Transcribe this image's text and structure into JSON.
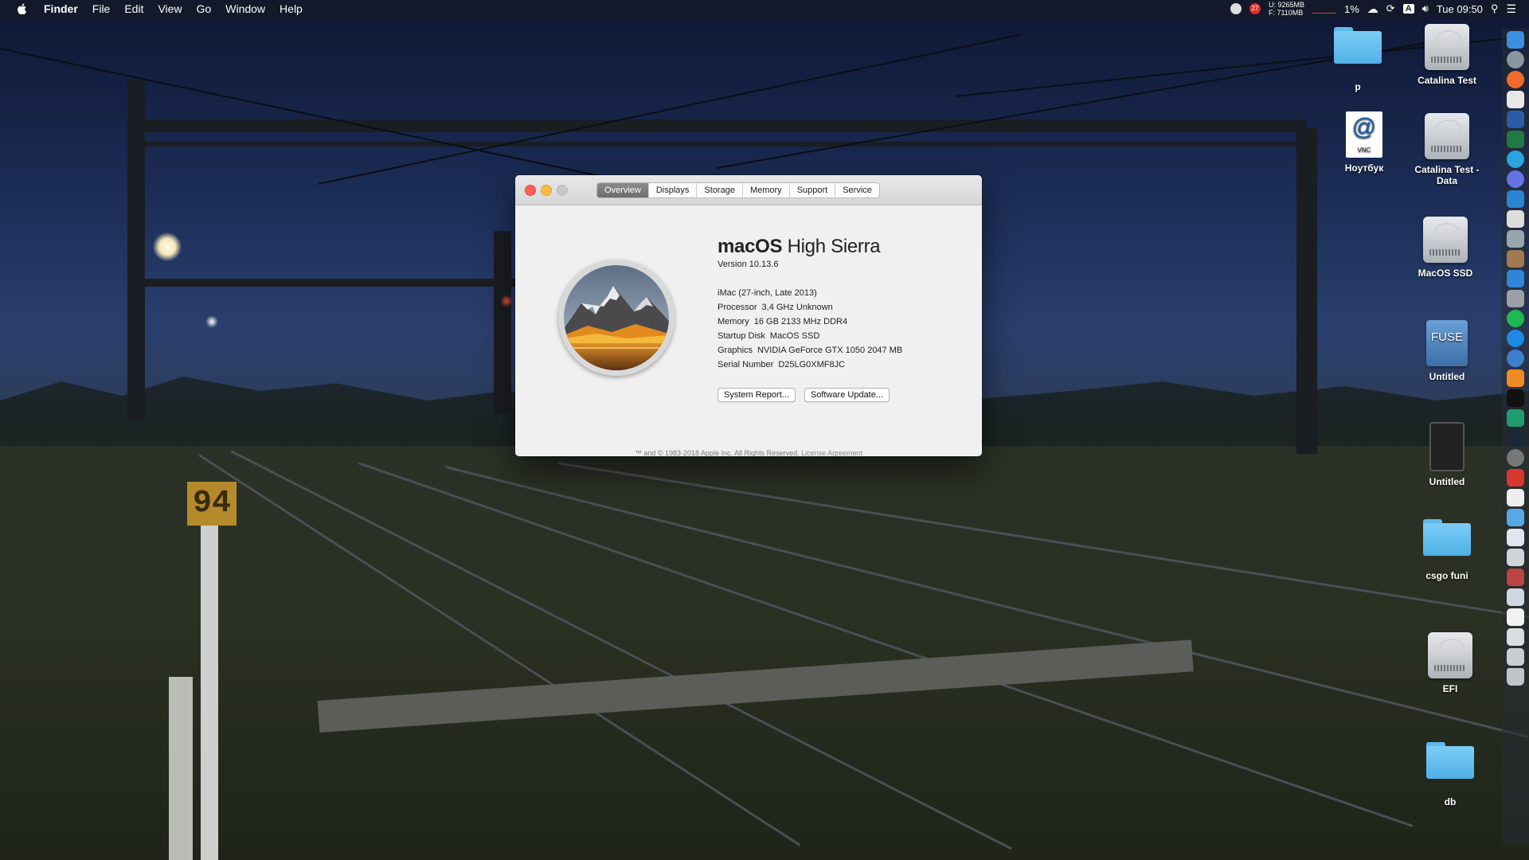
{
  "menubar": {
    "app": "Finder",
    "items": [
      "File",
      "Edit",
      "View",
      "Go",
      "Window",
      "Help"
    ],
    "status": {
      "notif_count": "27",
      "mem_used": "U: 9265MB",
      "mem_free": "F: 7110MB",
      "percent": "1%",
      "input_source": "A",
      "clock": "Tue 09:50"
    }
  },
  "desktop_icons": [
    {
      "label": "p"
    },
    {
      "label": "Catalina Test"
    },
    {
      "label": "Ноутбук",
      "vnc_text": "VNC"
    },
    {
      "label": "Catalina Test - Data"
    },
    {
      "label": "MacOS SSD"
    },
    {
      "label": "Untitled",
      "fuse_text": "FUSE"
    },
    {
      "label": "Untitled"
    },
    {
      "label": "csgo funi"
    },
    {
      "label": "EFI"
    },
    {
      "label": "db"
    }
  ],
  "wallpaper": {
    "sign_text": "94"
  },
  "window": {
    "tabs": [
      "Overview",
      "Displays",
      "Storage",
      "Memory",
      "Support",
      "Service"
    ],
    "active_tab": "Overview",
    "os_brand": "macOS",
    "os_name": "High Sierra",
    "version": "Version 10.13.6",
    "model": "iMac (27-inch, Late 2013)",
    "specs": [
      {
        "key": "Processor",
        "value": "3,4 GHz Unknown"
      },
      {
        "key": "Memory",
        "value": "16 GB 2133 MHz DDR4"
      },
      {
        "key": "Startup Disk",
        "value": "MacOS SSD"
      },
      {
        "key": "Graphics",
        "value": "NVIDIA GeForce GTX 1050 2047 MB"
      },
      {
        "key": "Serial Number",
        "value": "D25LG0XMF8JC"
      }
    ],
    "system_report_label": "System Report...",
    "software_update_label": "Software Update...",
    "footer_copyright": "™ and © 1983-2018 Apple Inc. All Rights Reserved.",
    "footer_license": "License Agreement"
  },
  "colors": {
    "close": "#fc605b",
    "minimize": "#fdbc40",
    "tab_active": "#7b7b7b",
    "folder": "#5fb9ee"
  }
}
